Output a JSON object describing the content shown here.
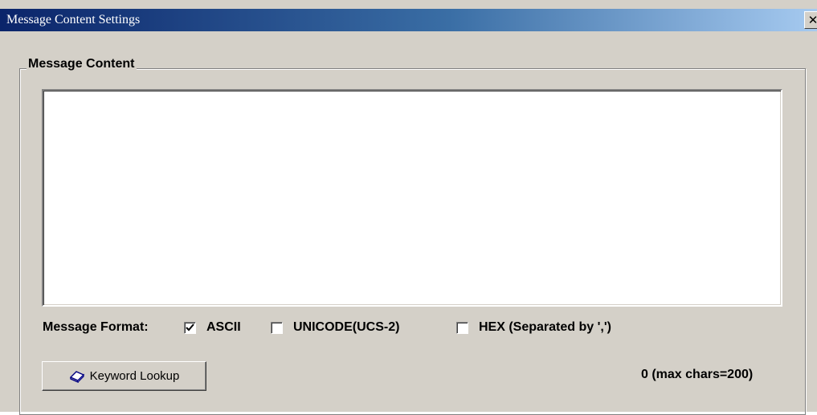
{
  "window": {
    "title": "Message Content Settings",
    "close_glyph": "✕"
  },
  "group": {
    "label": "Message Content"
  },
  "message": {
    "value": ""
  },
  "format": {
    "label": "Message Format:",
    "options": [
      {
        "label": "ASCII",
        "checked": true
      },
      {
        "label": "UNICODE(UCS-2)",
        "checked": false
      },
      {
        "label": "HEX (Separated by ',')",
        "checked": false
      }
    ]
  },
  "keyword_button": {
    "label": "Keyword Lookup",
    "icon": "keyword-lookup-icon"
  },
  "counter": {
    "text": "0 (max chars=200)"
  }
}
